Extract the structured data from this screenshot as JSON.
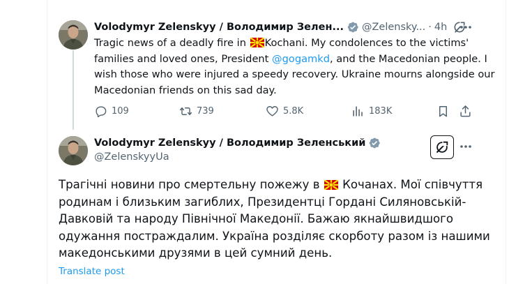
{
  "quoted_tweet": {
    "author_name": "Volodymyr Zelenskyy / Володимир Зелен...",
    "handle": "@Zelensky...",
    "separator": "·",
    "time": "4h",
    "text_part1": "Tragic news of a deadly fire in ",
    "text_part2": "Kochani. My condolences to the victims' families and loved ones, President ",
    "mention": "@gogamkd",
    "text_part3": ", and the Macedonian people. I wish those who were injured a speedy recovery. Ukraine mourns alongside our Macedonian friends on this sad day.",
    "actions": {
      "replies": "109",
      "reposts": "739",
      "likes": "5.8K",
      "views": "183K"
    }
  },
  "main_tweet": {
    "author_name": "Volodymyr Zelenskyy / Володимир Зеленський",
    "handle": "@ZelenskyyUa",
    "text_part1": "Трагічні новини про смертельну пожежу в ",
    "text_part2": " Кочанах. Мої співчуття родинам і близьким загиблих, Президентці Гордані Силяновській-Давковій та народу Північної Македонії. Бажаю якнайшвидшого одужання постраждалим. Україна розділяє скорботу разом із нашими македонськими друзями в цей сумний день.",
    "translate_label": "Translate post"
  },
  "colors": {
    "link": "#1d9bf0",
    "secondary_text": "#536471",
    "verified": "#829aab",
    "flag_red": "#d20000",
    "flag_yellow": "#ffe600"
  }
}
